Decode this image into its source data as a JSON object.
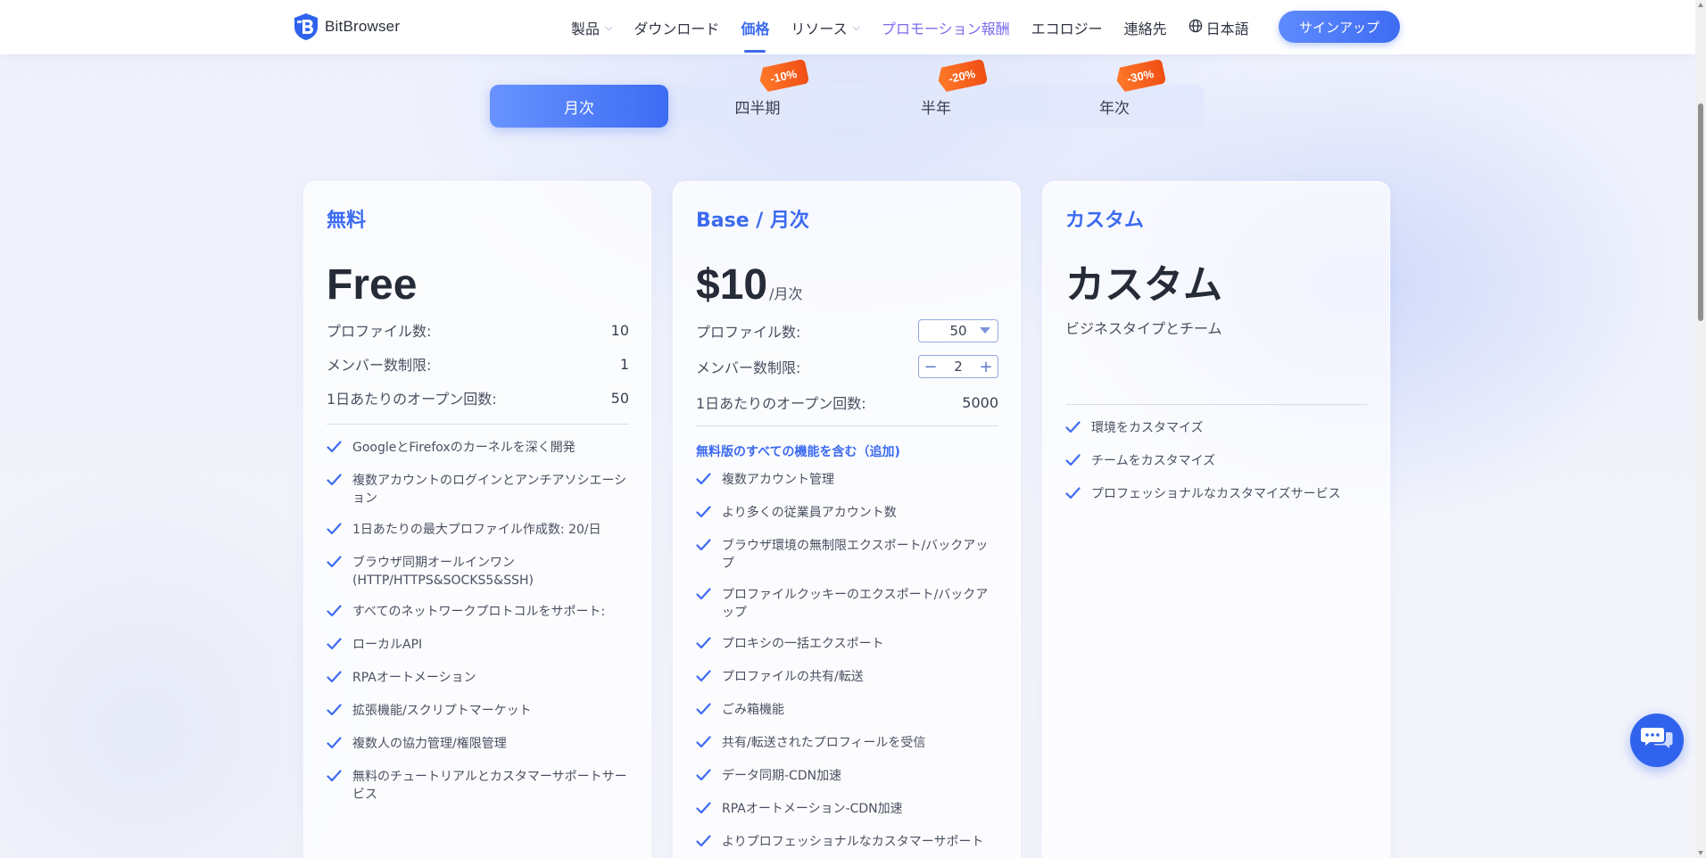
{
  "header": {
    "brand": "BitBrowser",
    "nav": [
      {
        "label": "製品",
        "has_dropdown": true
      },
      {
        "label": "ダウンロード",
        "has_dropdown": false
      },
      {
        "label": "価格",
        "has_dropdown": false,
        "active": true
      },
      {
        "label": "リソース",
        "has_dropdown": true
      },
      {
        "label": "プロモーション報酬",
        "has_dropdown": false
      },
      {
        "label": "エコロジー",
        "has_dropdown": false
      },
      {
        "label": "連絡先",
        "has_dropdown": false
      }
    ],
    "language": "日本語",
    "signup_label": "サインアップ"
  },
  "period_tabs": [
    {
      "label": "月次",
      "active": true,
      "discount": ""
    },
    {
      "label": "四半期",
      "active": false,
      "discount": "-10%"
    },
    {
      "label": "半年",
      "active": false,
      "discount": "-20%"
    },
    {
      "label": "年次",
      "active": false,
      "discount": "-30%"
    }
  ],
  "plans": {
    "free": {
      "label": "無料",
      "price": "Free",
      "stats": [
        {
          "label": "プロファイル数:",
          "value": "10"
        },
        {
          "label": "メンバー数制限:",
          "value": "1"
        },
        {
          "label": "1日あたりのオープン回数:",
          "value": "50"
        }
      ],
      "features": [
        "GoogleとFirefoxのカーネルを深く開発",
        "複数アカウントのログインとアンチアソシエーション",
        "1日あたりの最大プロファイル作成数: 20/日",
        "ブラウザ同期オールインワン(HTTP/HTTPS&SOCKS5&SSH)",
        "すべてのネットワークプロトコルをサポート:",
        "ローカルAPI",
        "RPAオートメーション",
        "拡張機能/スクリプトマーケット",
        "複数人の協力管理/権限管理",
        "無料のチュートリアルとカスタマーサポートサービス"
      ]
    },
    "base": {
      "label": "Base / 月次",
      "price": "$10",
      "per": "/月次",
      "profiles_label": "プロファイル数:",
      "profiles_value": "50",
      "members_label": "メンバー数制限:",
      "members_value": "2",
      "opens_label": "1日あたりのオープン回数:",
      "opens_value": "5000",
      "includes_note": "無料版のすべての機能を含む（追加)",
      "features": [
        "複数アカウント管理",
        "より多くの従業員アカウント数",
        "ブラウザ環境の無制限エクスポート/バックアップ",
        "プロファイルクッキーのエクスポート/バックアップ",
        "プロキシの一括エクスポート",
        "プロファイルの共有/転送",
        "ごみ箱機能",
        "共有/転送されたプロフィールを受信",
        "データ同期-CDN加速",
        "RPAオートメーション-CDN加速",
        "よりプロフェッショナルなカスタマーサポート"
      ]
    },
    "custom": {
      "label": "カスタム",
      "price": "カスタム",
      "subtitle": "ビジネスタイプとチーム",
      "features": [
        "環境をカスタマイズ",
        "チームをカスタマイズ",
        "プロフェッショナルなカスタマイズサービス"
      ]
    }
  },
  "colors": {
    "accent": "#3d6bf0",
    "discount": "#f04e14",
    "promo_link": "#7a6bf0"
  },
  "icons": {
    "check": "check-icon",
    "chat": "chat-icon",
    "globe": "globe-icon"
  }
}
